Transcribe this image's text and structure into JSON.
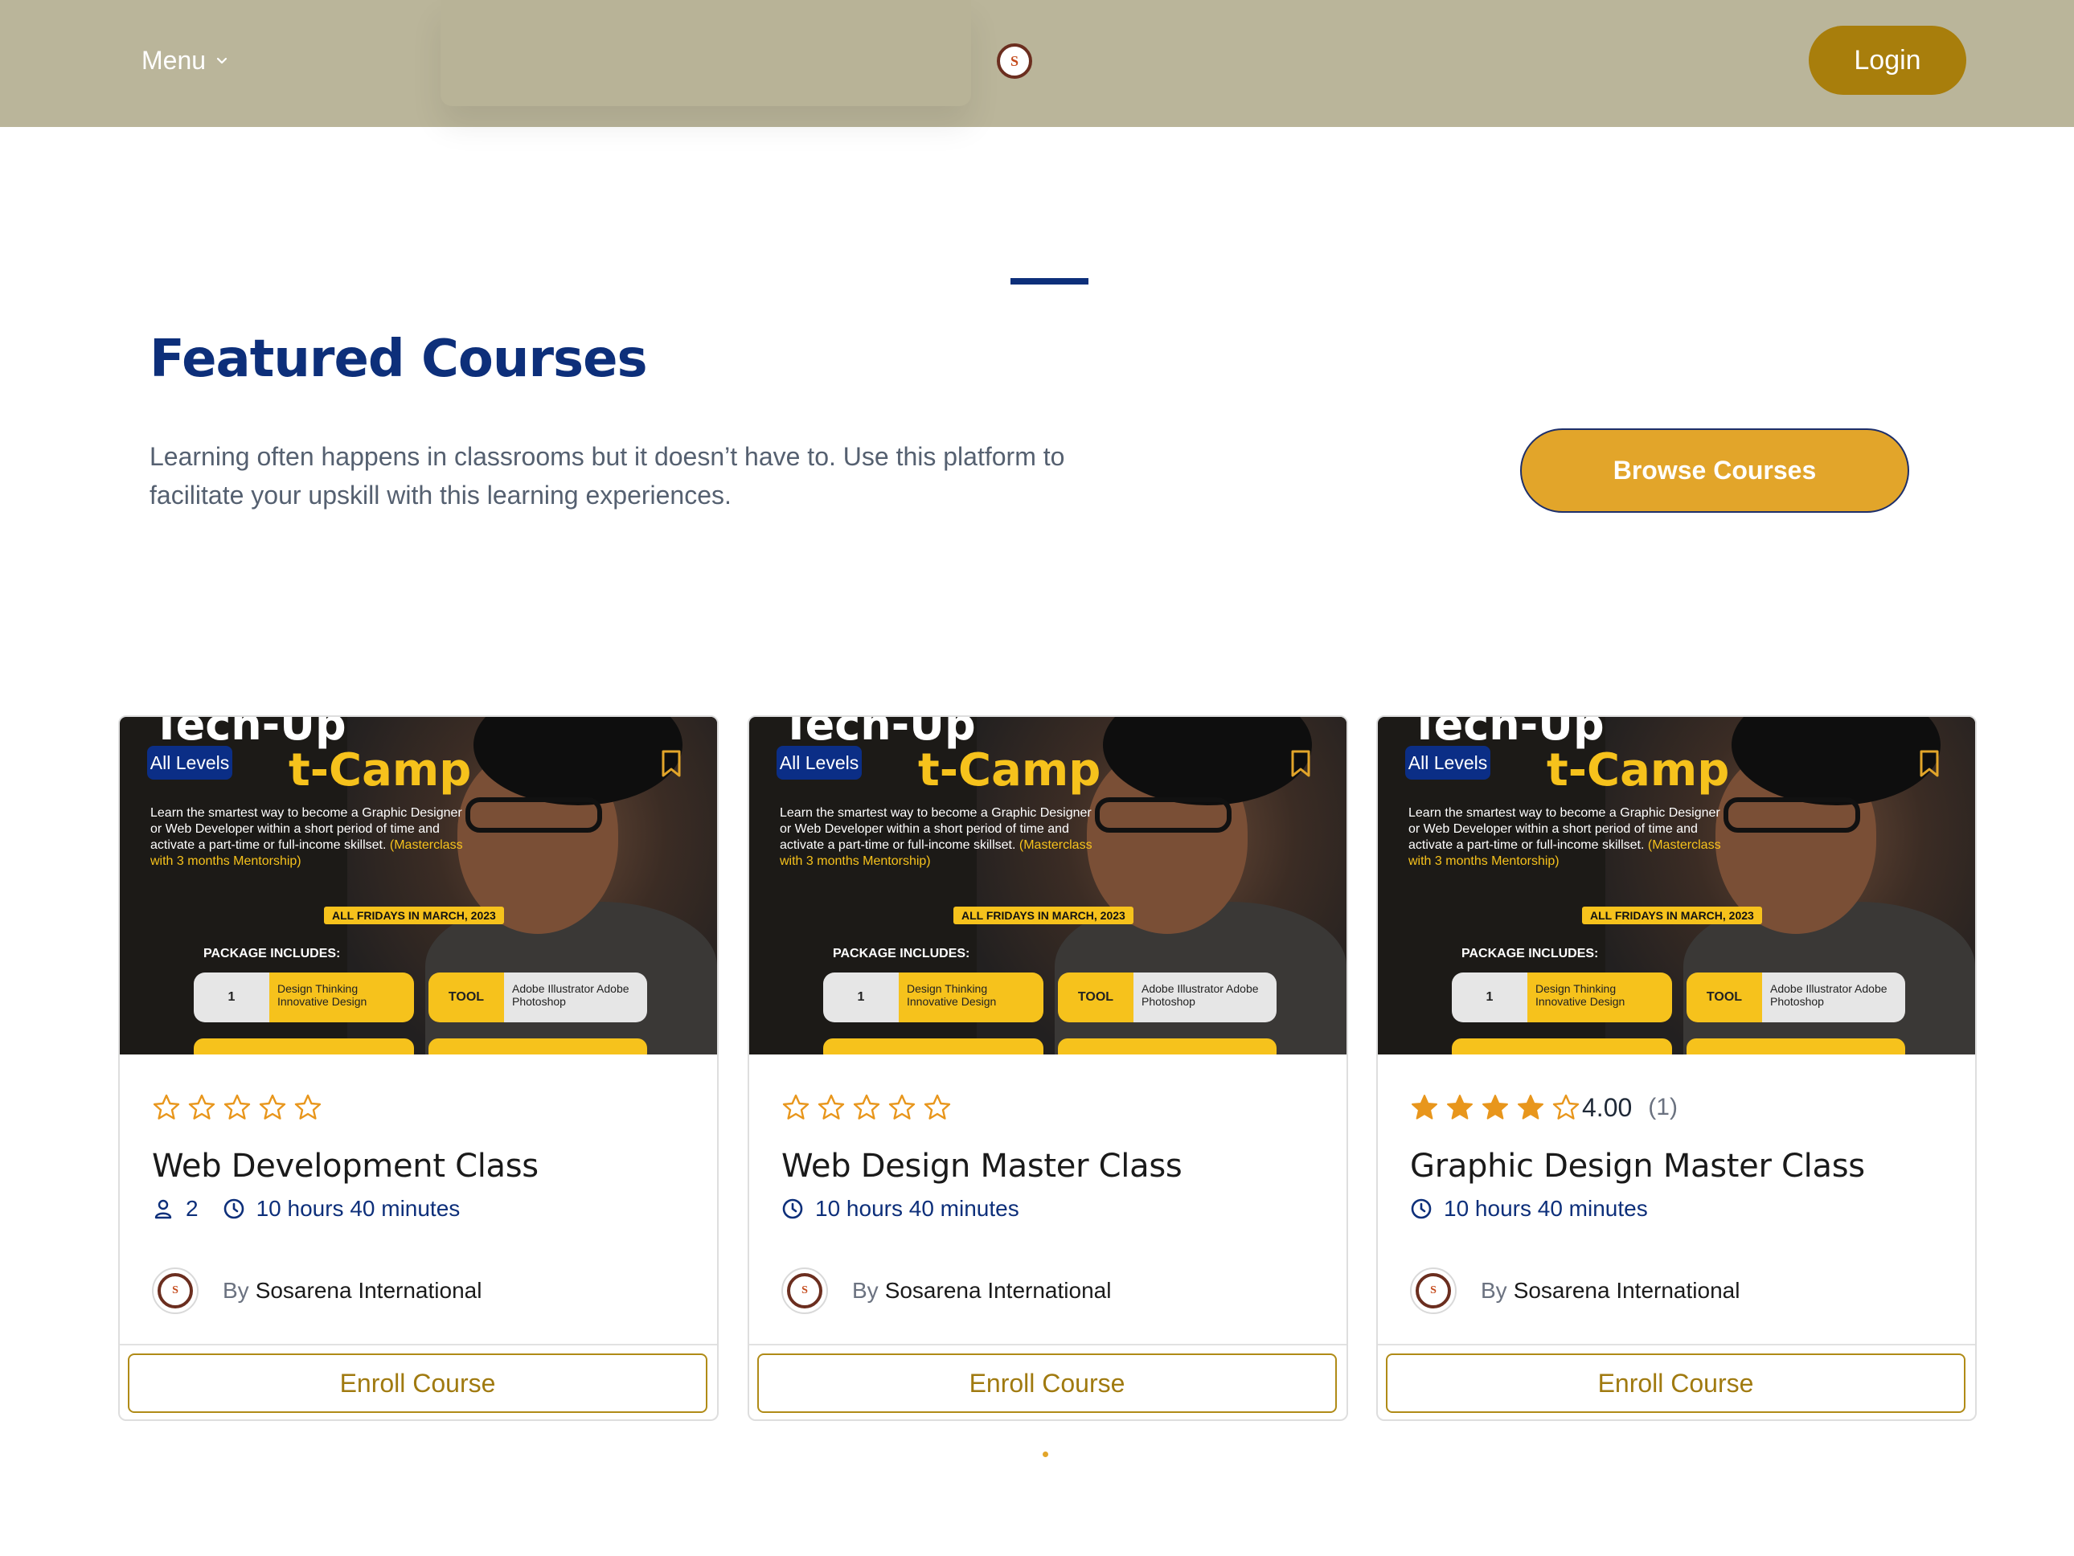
{
  "header": {
    "menu_label": "Menu",
    "login_label": "Login",
    "logo_text": "S"
  },
  "section": {
    "title": "Featured Courses",
    "description": "Learning often happens in classrooms but it doesn’t have to. Use this platform to facilitate your upskill with this learning experiences.",
    "browse_label": "Browse Courses"
  },
  "thumbnail": {
    "headline_top": "Tech-Up",
    "headline_camp": "t-Camp",
    "blurb": "Learn the smartest way to become a Graphic Designer or Web Developer within a short period of time and activate a part-time or full-income skillset.",
    "blurb_highlight": "(Masterclass with 3 months Mentorship)",
    "date_tag": "ALL FRIDAYS IN MARCH, 2023",
    "package_label": "PACKAGE INCLUDES:",
    "pill1_num": "1",
    "pill1_text": "Design Thinking Innovative Design",
    "pill2_tag": "TOOL",
    "pill2_text": "Adobe Illustrator Adobe Photoshop"
  },
  "courses": [
    {
      "level": "All Levels",
      "rating_value": 0,
      "rating_text": "",
      "rating_count": "",
      "title": "Web Development Class",
      "students": "2",
      "duration": "10 hours 40 minutes",
      "by_label": "By",
      "author": "Sosarena International",
      "enroll_label": "Enroll Course"
    },
    {
      "level": "All Levels",
      "rating_value": 0,
      "rating_text": "",
      "rating_count": "",
      "title": "Web Design Master Class",
      "students": "",
      "duration": "10 hours 40 minutes",
      "by_label": "By",
      "author": "Sosarena International",
      "enroll_label": "Enroll Course"
    },
    {
      "level": "All Levels",
      "rating_value": 4,
      "rating_text": "4.00",
      "rating_count": "(1)",
      "title": "Graphic Design Master Class",
      "students": "",
      "duration": "10 hours 40 minutes",
      "by_label": "By",
      "author": "Sosarena International",
      "enroll_label": "Enroll Course"
    }
  ],
  "colors": {
    "header_bg": "#bab59a",
    "login_bg": "#a87e0c",
    "brand_blue": "#0d2f7a",
    "accent_gold": "#e2a52a",
    "star": "#e8961c",
    "enroll_border": "#b08b17"
  },
  "icons": {
    "menu": "chevron-down-icon",
    "students": "user-icon",
    "duration": "clock-icon",
    "bookmark": "bookmark-icon",
    "star": "star-icon"
  }
}
